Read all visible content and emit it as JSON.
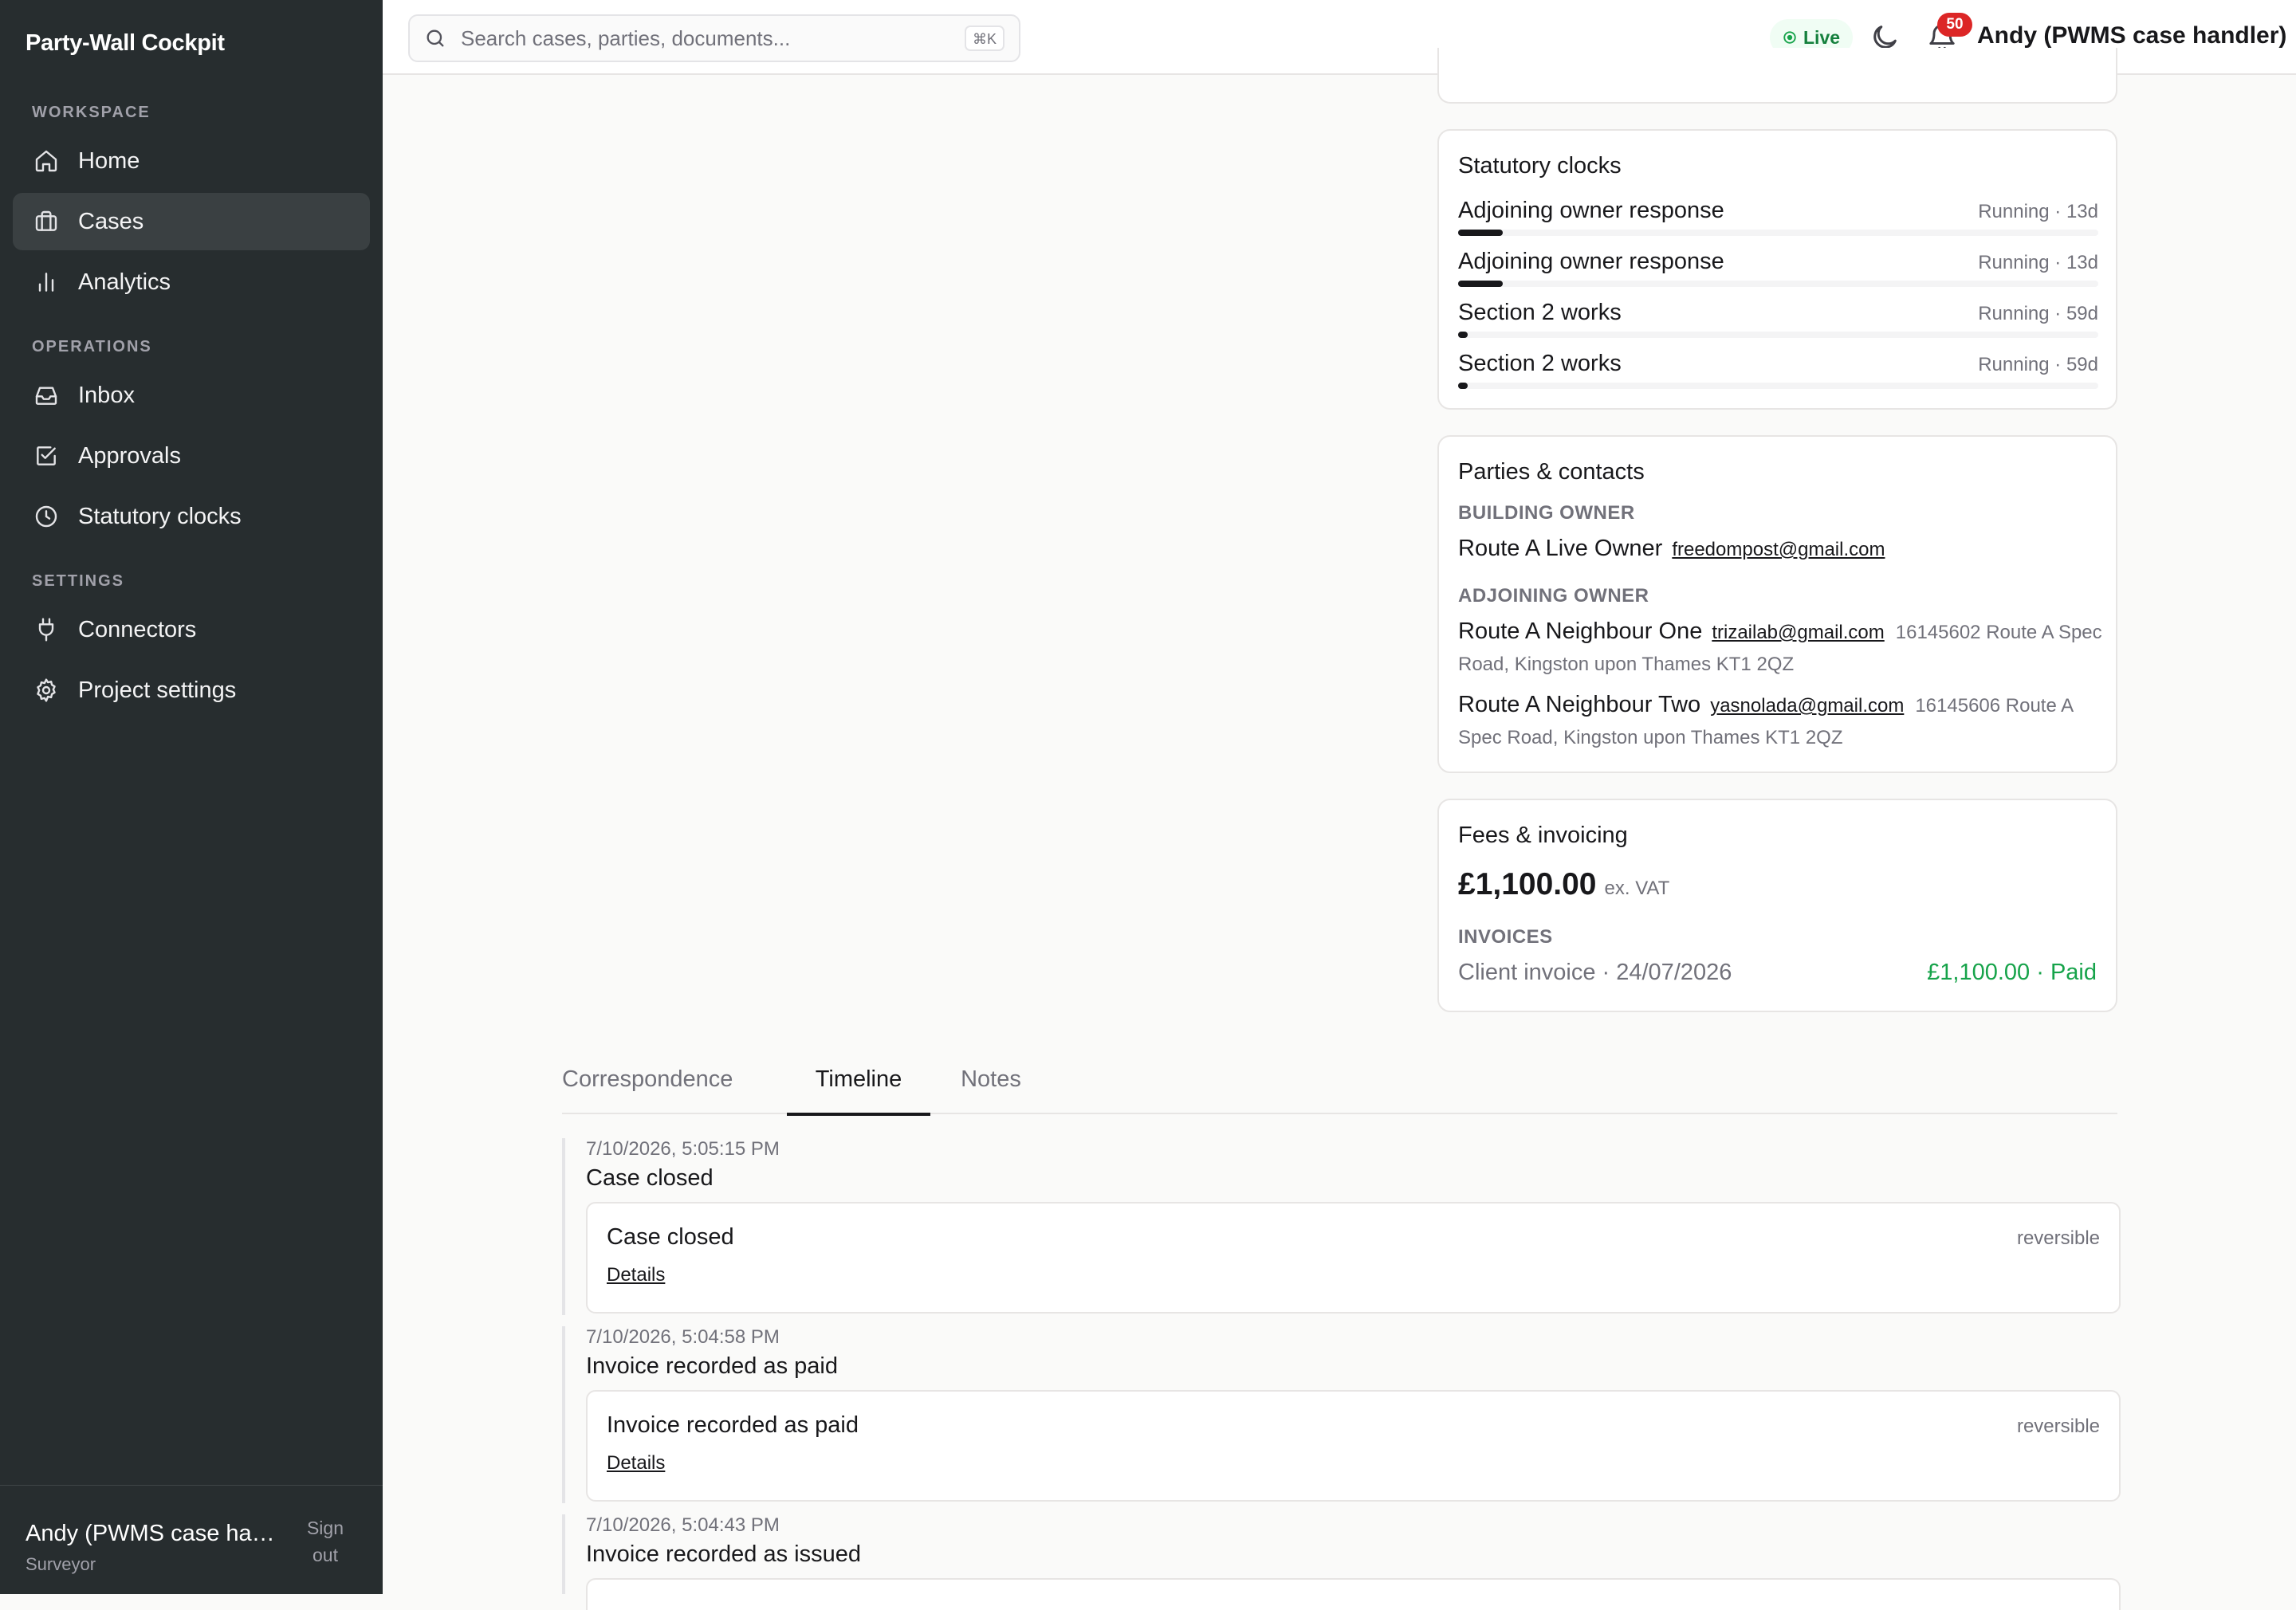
{
  "app": {
    "title": "Party-Wall Cockpit"
  },
  "sidebar": {
    "sections": [
      {
        "label": "WORKSPACE",
        "items": [
          {
            "label": "Home",
            "icon": "home-icon"
          },
          {
            "label": "Cases",
            "icon": "briefcase-icon",
            "active": true
          },
          {
            "label": "Analytics",
            "icon": "bar-chart-icon"
          }
        ]
      },
      {
        "label": "OPERATIONS",
        "items": [
          {
            "label": "Inbox",
            "icon": "inbox-icon"
          },
          {
            "label": "Approvals",
            "icon": "check-square-icon"
          },
          {
            "label": "Statutory clocks",
            "icon": "clock-icon"
          }
        ]
      },
      {
        "label": "SETTINGS",
        "items": [
          {
            "label": "Connectors",
            "icon": "plug-icon"
          },
          {
            "label": "Project settings",
            "icon": "gear-icon"
          }
        ]
      }
    ],
    "footer": {
      "name": "Andy (PWMS case handler)",
      "role": "Surveyor",
      "signout": "Sign out"
    }
  },
  "topbar": {
    "search_placeholder": "Search cases, parties, documents...",
    "shortcut": "⌘K",
    "live_label": "Live",
    "notifications_count": "50",
    "user": "Andy (PWMS case handler)"
  },
  "statutory_clocks": {
    "title": "Statutory clocks",
    "items": [
      {
        "name": "Adjoining owner response",
        "status": "Running · 13d",
        "progress": 0.07
      },
      {
        "name": "Adjoining owner response",
        "status": "Running · 13d",
        "progress": 0.07
      },
      {
        "name": "Section 2 works",
        "status": "Running · 59d",
        "progress": 0.015
      },
      {
        "name": "Section 2 works",
        "status": "Running · 59d",
        "progress": 0.015
      }
    ]
  },
  "parties": {
    "title": "Parties & contacts",
    "building_owner_label": "BUILDING OWNER",
    "building_owner": {
      "name": "Route A Live Owner",
      "email": "freedompost@gmail.com"
    },
    "adjoining_owner_label": "ADJOINING OWNER",
    "adjoining_owners": [
      {
        "name": "Route A Neighbour One",
        "email": "trizailab@gmail.com",
        "address": "16145602 Route A Spec Road, Kingston upon Thames KT1 2QZ"
      },
      {
        "name": "Route A Neighbour Two",
        "email": "yasnolada@gmail.com",
        "address": "16145606 Route A Spec Road, Kingston upon Thames KT1 2QZ"
      }
    ]
  },
  "fees": {
    "title": "Fees & invoicing",
    "amount": "£1,100.00",
    "vat_note": "ex. VAT",
    "invoices_label": "INVOICES",
    "invoices": [
      {
        "name": "Client invoice · 24/07/2026",
        "amount": "£1,100.00 · Paid"
      }
    ]
  },
  "tabs": [
    {
      "label": "Correspondence"
    },
    {
      "label": "Timeline",
      "active": true
    },
    {
      "label": "Notes"
    }
  ],
  "timeline": [
    {
      "time": "7/10/2026, 5:05:15 PM",
      "heading": "Case closed",
      "card_title": "Case closed",
      "tag": "reversible",
      "details": "Details"
    },
    {
      "time": "7/10/2026, 5:04:58 PM",
      "heading": "Invoice recorded as paid",
      "card_title": "Invoice recorded as paid",
      "tag": "reversible",
      "details": "Details"
    },
    {
      "time": "7/10/2026, 5:04:43 PM",
      "heading": "Invoice recorded as issued"
    }
  ]
}
